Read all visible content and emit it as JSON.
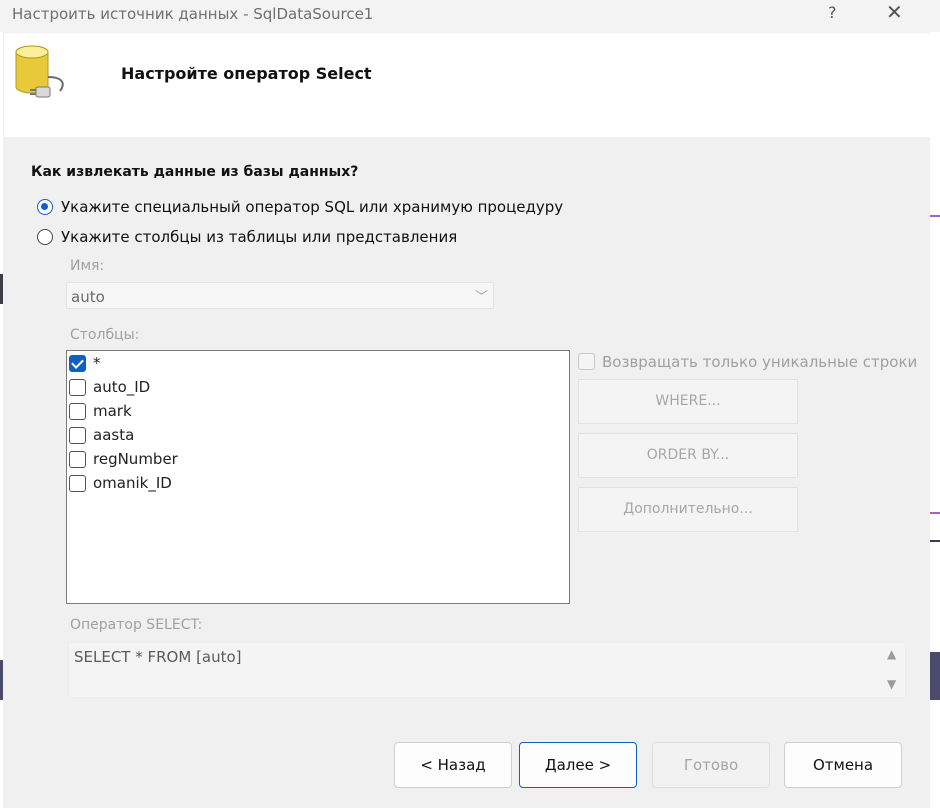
{
  "window": {
    "title": "Настроить источник данных - SqlDataSource1",
    "help_glyph": "?",
    "close_glyph": "✕"
  },
  "header": {
    "heading": "Настройте оператор Select",
    "icon": "database-plug-icon"
  },
  "question": "Как извлекать данные из базы данных?",
  "options": {
    "custom_sql": {
      "label": "Укажите специальный оператор SQL или хранимую процедуру",
      "selected": true
    },
    "table_columns": {
      "label": "Укажите столбцы из таблицы или представления",
      "selected": false
    }
  },
  "name_field": {
    "label": "Имя:",
    "value": "auto"
  },
  "columns": {
    "label": "Столбцы:",
    "items": [
      {
        "name": "*",
        "checked": true
      },
      {
        "name": "auto_ID",
        "checked": false
      },
      {
        "name": "mark",
        "checked": false
      },
      {
        "name": "aasta",
        "checked": false
      },
      {
        "name": "regNumber",
        "checked": false
      },
      {
        "name": "omanik_ID",
        "checked": false
      }
    ]
  },
  "unique_rows": {
    "label": "Возвращать только уникальные строки",
    "checked": false
  },
  "side_buttons": {
    "where": "WHERE...",
    "order_by": "ORDER BY...",
    "advanced": "Дополнительно..."
  },
  "select_statement": {
    "label": "Оператор SELECT:",
    "value": "SELECT * FROM [auto]"
  },
  "footer": {
    "back": "< Назад",
    "next": "Далее >",
    "finish": "Готово",
    "cancel": "Отмена"
  },
  "colors": {
    "accent": "#0f5fc7",
    "disabled_text": "#a0a0a0"
  }
}
